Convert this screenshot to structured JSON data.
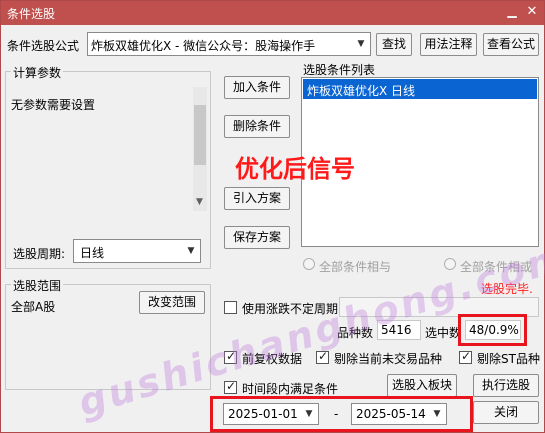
{
  "window": {
    "title": "条件选股",
    "minimize_glyph": "▁",
    "close_glyph": "✕"
  },
  "formula": {
    "label": "条件选股公式",
    "value": "炸板双雄优化X  -  微信公众号：股海操作手",
    "find_button": "查找",
    "usage_button": "用法注释",
    "view_button": "查看公式"
  },
  "params": {
    "group_label": "计算参数",
    "text": "无参数需要设置",
    "period_label": "选股周期:",
    "period_value": "日线"
  },
  "actions": {
    "add": "加入条件",
    "delete": "删除条件",
    "import": "引入方案",
    "save": "保存方案"
  },
  "condition_list": {
    "label": "选股条件列表",
    "items": [
      "炸板双雄优化X  日线"
    ],
    "selected_index": 0
  },
  "logic": {
    "and_label": "全部条件相与",
    "or_label": "全部条件相或"
  },
  "status": {
    "text": "选股完毕.",
    "color": "#ff2020"
  },
  "range": {
    "group_label": "选股范围",
    "value": "全部A股",
    "change_button": "改变范围"
  },
  "options": {
    "uncertain_period": "使用涨跌不定周期",
    "count_label": "品种数",
    "count_value": "5416",
    "selected_label": "选中数",
    "selected_value": "48/0.9%",
    "pre_adjust": "前复权数据",
    "exclude_untraded": "剔除当前未交易品种",
    "exclude_st": "剔除ST品种",
    "time_range": "时间段内满足条件",
    "to_block_button": "选股入板块",
    "execute_button": "执行选股"
  },
  "dates": {
    "start": "2025-01-01",
    "separator": "-",
    "end": "2025-05-14",
    "close_button": "关闭"
  },
  "overlay": {
    "annotation": "优化后信号",
    "watermark": "gushichanghong.com"
  },
  "colors": {
    "title_bar": "#c0504d",
    "selection": "#0a64d2",
    "annotation_red": "#ff1a1a",
    "highlight_box": "#e8141e"
  }
}
